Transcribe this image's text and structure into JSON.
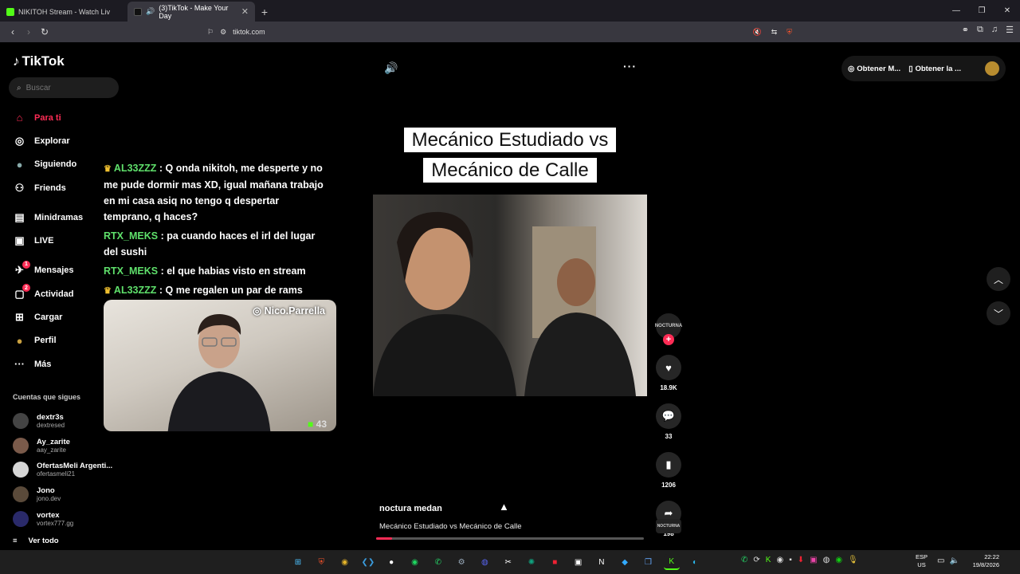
{
  "browser": {
    "tabs": [
      {
        "title": "NIKITOH Stream - Watch Live on",
        "favicon_color": "#53fc18"
      },
      {
        "title": "(3)TikTok - Make Your Day",
        "favicon_color": "#111111"
      }
    ],
    "url": "tiktok.com"
  },
  "sidebar": {
    "logo": "TikTok",
    "search_placeholder": "Buscar",
    "nav": [
      {
        "label": "Para ti",
        "icon": "home-icon",
        "active": true
      },
      {
        "label": "Explorar",
        "icon": "compass-icon"
      },
      {
        "label": "Siguiendo",
        "icon": "following-avatar-icon"
      },
      {
        "label": "Friends",
        "icon": "friends-icon"
      },
      {
        "label": "Minidramas",
        "icon": "film-icon"
      },
      {
        "label": "LIVE",
        "icon": "live-icon"
      },
      {
        "label": "Mensajes",
        "icon": "message-icon",
        "badge": "1"
      },
      {
        "label": "Actividad",
        "icon": "activity-icon",
        "badge": "2"
      },
      {
        "label": "Cargar",
        "icon": "upload-icon"
      },
      {
        "label": "Perfil",
        "icon": "profile-avatar-icon"
      },
      {
        "label": "Más",
        "icon": "more-icon"
      }
    ],
    "following_header": "Cuentas que sigues",
    "following": [
      {
        "name": "dextr3s",
        "handle": "dextresed",
        "color": "#444444"
      },
      {
        "name": "Ay_zarite",
        "handle": "aay_zarite",
        "color": "#7a5a4a"
      },
      {
        "name": "OfertasMeli Argenti...",
        "handle": "ofertasmeli21",
        "color": "#d6d6d6"
      },
      {
        "name": "Jono",
        "handle": "jono.dev",
        "color": "#5a4a3a"
      },
      {
        "name": "vortex",
        "handle": "vortex777.gg",
        "color": "#2a2a6a"
      }
    ],
    "see_all": "Ver todo"
  },
  "chat": [
    {
      "user": "AL33ZZZ",
      "crown": true,
      "text": ": Q onda nikitoh, me desperte y no me pude dormir mas XD, igual mañana trabajo en mi casa asiq no tengo q despertar temprano, q haces?"
    },
    {
      "user": "RTX_MEKS",
      "crown": false,
      "text": ": pa cuando haces el irl del lugar del sushi"
    },
    {
      "user": "RTX_MEKS",
      "crown": false,
      "text": ": el que habias visto en stream"
    },
    {
      "user": "AL33ZZZ",
      "crown": true,
      "text": ": Q me regalen un par de rams"
    }
  ],
  "webcam": {
    "instagram": "Nico.Parrella",
    "counter": "43"
  },
  "video": {
    "caption_line1": "Mecánico Estudiado vs",
    "caption_line2": "Mecánico de Calle",
    "author": "noctura medan",
    "description": "Mecánico Estudiado vs Mecánico de Calle",
    "progress": 0.06,
    "creator_badge": "NOCTURNA",
    "likes": "18.9K",
    "comments": "33",
    "saves": "1206",
    "shares": "198"
  },
  "topbar": {
    "get_coins": "Obtener M...",
    "get_app": "Obtener la ..."
  },
  "taskbar": {
    "lang_top": "ESP",
    "lang_bottom": "US",
    "time": "22:22",
    "date": "19/8/2026",
    "colors": {
      "accent": "#fe2c55",
      "kick": "#53fc18"
    }
  }
}
